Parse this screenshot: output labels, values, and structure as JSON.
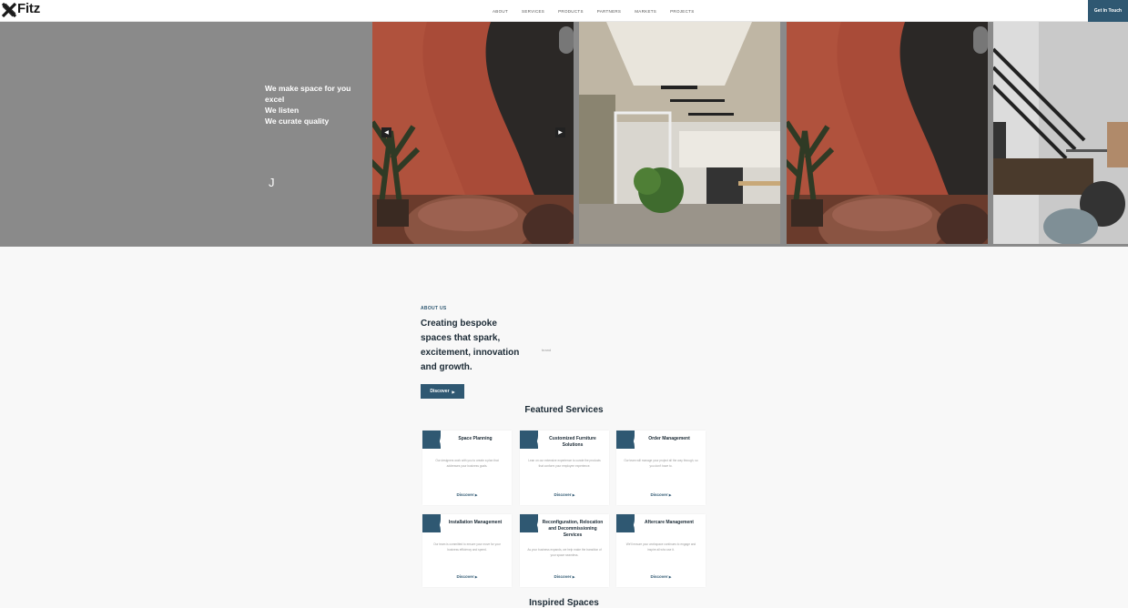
{
  "header": {
    "logo_text": "Fitz",
    "logo_tagline": "",
    "nav": [
      "ABOUT",
      "SERVICES",
      "PRODUCTS",
      "PARTNERS",
      "MARKETS",
      "PROJECTS"
    ],
    "cta_label": "Get In Touch"
  },
  "hero": {
    "lines": [
      "We make space for you",
      "excel",
      "We listen",
      "We curate quality"
    ],
    "cursor": "J",
    "prev_icon": "chevron-left-icon",
    "next_icon": "chevron-right-icon"
  },
  "about": {
    "label": "ABOUT US",
    "heading": "Creating bespoke spaces that spark, excitement, innovation and growth.",
    "image_alt": "brand",
    "button": "Discover"
  },
  "featured": {
    "title": "Featured Services",
    "cards": [
      {
        "title": "Space Planning",
        "desc": "Our designers work with you to create a plan that addresses your business goals.",
        "link": "Discover"
      },
      {
        "title": "Customized Furniture Solutions",
        "desc": "Lean on our extensive experience to curate the products that conform your employee experience.",
        "link": "Discover"
      },
      {
        "title": "Order Management",
        "desc": "Our team will manage your project all the way through, so you don't have to.",
        "link": "Discover"
      },
      {
        "title": "Installation Management",
        "desc": "Our team is committed to ensure your move for your business efficiency and speed.",
        "link": "Discover"
      },
      {
        "title": "Reconfiguration, Relocation and Decommissioning Services",
        "desc": "As your business expands, we help make the transition of your space seamless.",
        "link": "Discover"
      },
      {
        "title": "Aftercare Management",
        "desc": "We'll ensure your workspace continues to engage and inspire all who use it.",
        "link": "Discover"
      }
    ]
  },
  "inspired": {
    "title": "Inspired Spaces"
  },
  "colors": {
    "accent": "#2f5872",
    "hero_bg": "#8a8a8a",
    "terracotta": "#b0523d"
  }
}
